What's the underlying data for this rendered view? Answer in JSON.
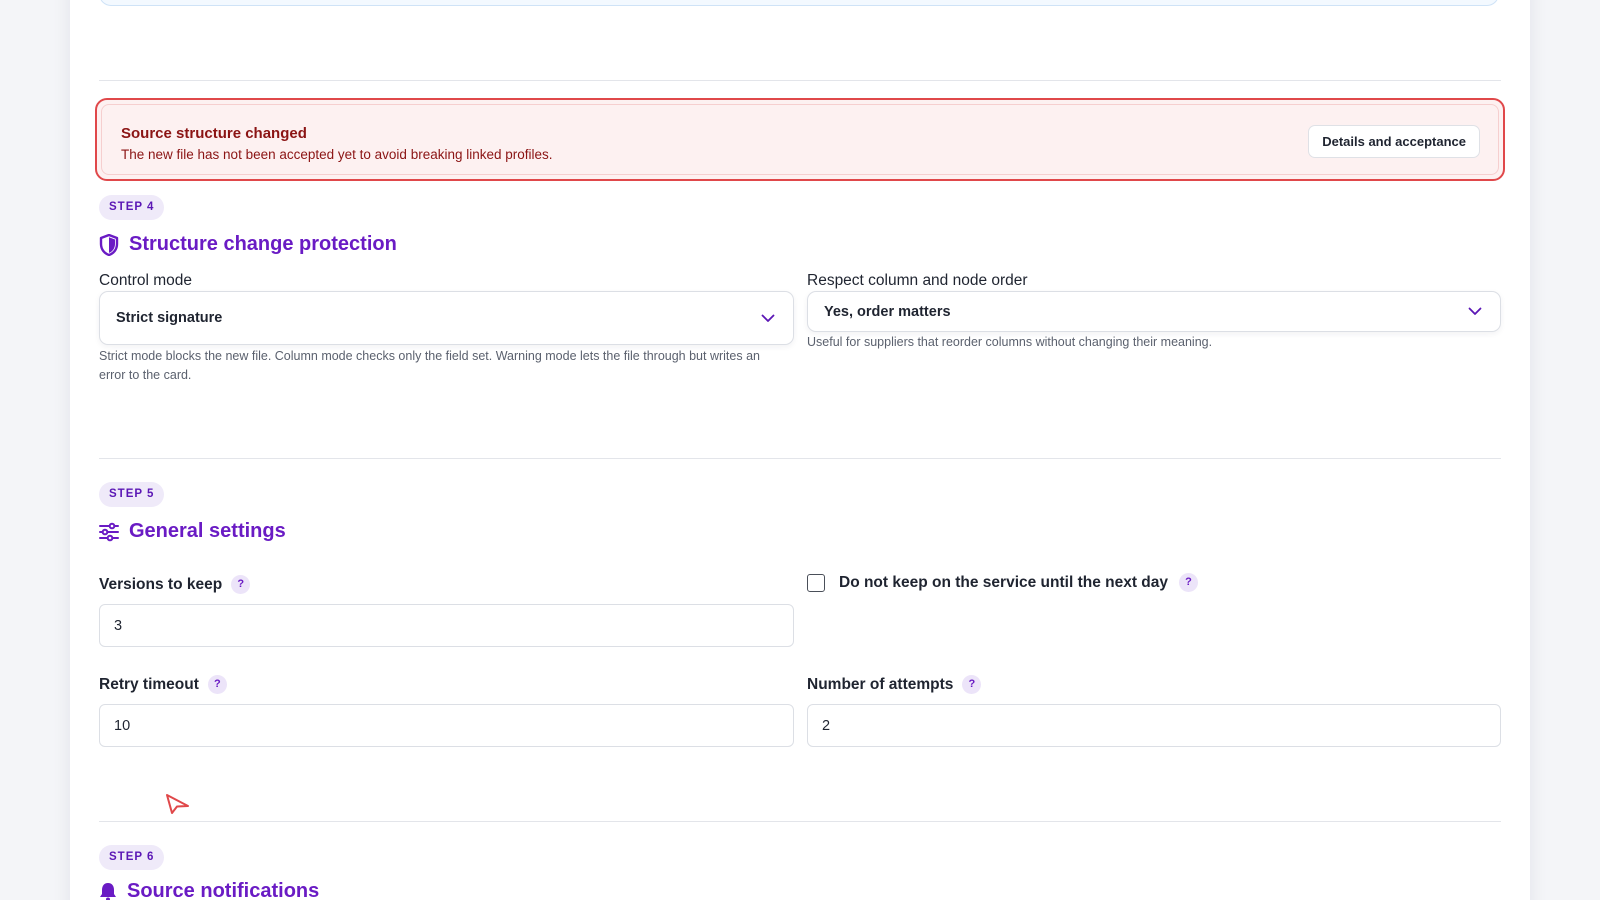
{
  "alert": {
    "title": "Source structure changed",
    "text": "The new file has not been accepted yet to avoid breaking linked profiles.",
    "button_label": "Details and acceptance"
  },
  "step4": {
    "badge": "STEP 4",
    "title": "Structure change protection",
    "icon": "shield-icon",
    "control_mode": {
      "label": "Control mode",
      "value": "Strict signature",
      "hint": "Strict mode blocks the new file. Column mode checks only the field set. Warning mode lets the file through but writes an error to the card."
    },
    "order": {
      "label": "Respect column and node order",
      "value": "Yes, order matters",
      "hint": "Useful for suppliers that reorder columns without changing their meaning."
    }
  },
  "step5": {
    "badge": "STEP 5",
    "title": "General settings",
    "icon": "sliders-icon",
    "versions": {
      "label": "Versions to keep",
      "value": "3"
    },
    "no_keep": {
      "label": "Do not keep on the service until the next day",
      "checked": false
    },
    "retry_timeout": {
      "label": "Retry timeout",
      "value": "10"
    },
    "attempts": {
      "label": "Number of attempts",
      "value": "2"
    },
    "help_glyph": "?"
  },
  "step6": {
    "badge": "STEP 6",
    "title": "Source notifications",
    "icon": "bell-icon"
  },
  "colors": {
    "accent": "#6a1bc4",
    "alert_border": "#e0484a",
    "alert_text": "#8b1414"
  }
}
